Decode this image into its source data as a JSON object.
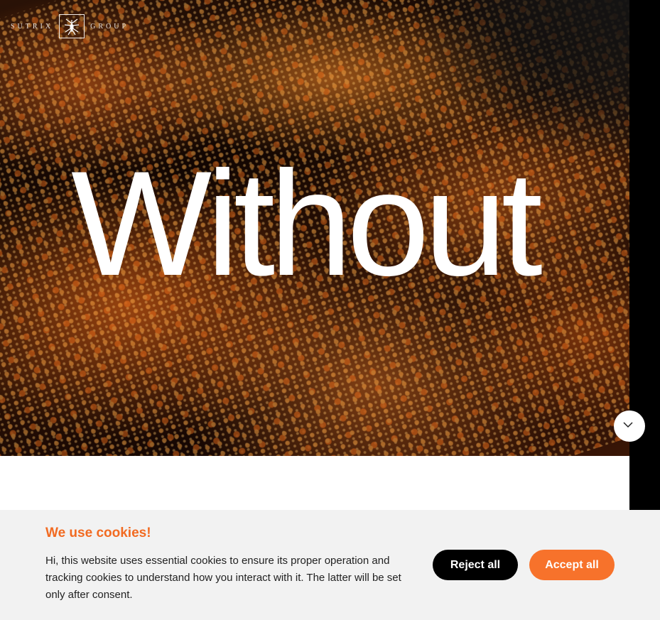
{
  "brand": {
    "left_text": "SUTRIX",
    "right_text": "GROUP",
    "logo_icon": "spider-logo-icon"
  },
  "hero": {
    "headline": "Without",
    "scroll_icon": "chevron-down-icon"
  },
  "cookies": {
    "title": "We use cookies!",
    "message": "Hi, this website uses essential cookies to ensure its proper operation and tracking cookies to understand how you interact with it. The latter will be set only after consent.",
    "reject_label": "Reject all",
    "accept_label": "Accept all"
  },
  "colors": {
    "accent": "#f7722b",
    "title_accent": "#f26b22",
    "banner_bg": "#f2f2f2",
    "reject_bg": "#000000"
  }
}
